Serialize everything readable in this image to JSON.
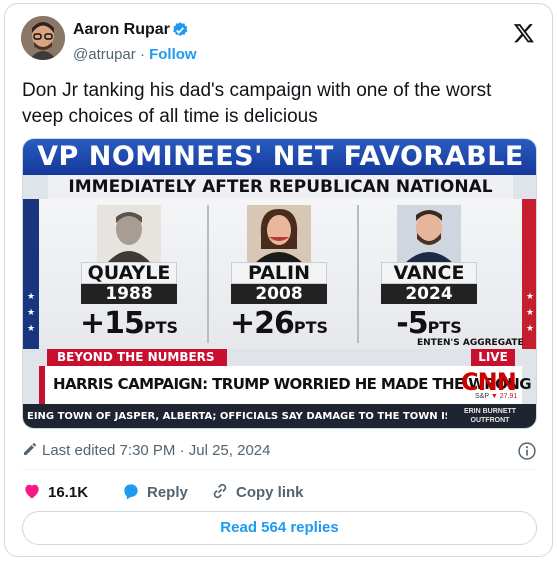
{
  "author": {
    "name": "Aaron Rupar",
    "handle": "@atrupar",
    "separator": "·",
    "follow_label": "Follow"
  },
  "tweet_text": "Don Jr tanking his dad's campaign with one of the worst veep choices of all time is delicious",
  "media": {
    "title": "VP NOMINEES' NET FAVORABLE RATING",
    "subtitle": "IMMEDIATELY AFTER REPUBLICAN NATIONAL CONVENTION",
    "candidates": [
      {
        "name": "QUAYLE",
        "year": "1988",
        "value": "+15",
        "unit": "PTS"
      },
      {
        "name": "PALIN",
        "year": "2008",
        "value": "+26",
        "unit": "PTS"
      },
      {
        "name": "VANCE",
        "year": "2024",
        "value": "-5",
        "unit": "PTS"
      }
    ],
    "aggregate_label": "ENTEN'S AGGREGATE",
    "segment_label": "BEYOND THE NUMBERS",
    "live_label": "LIVE",
    "headline": "HARRIS CAMPAIGN: TRUMP WORRIED HE MADE THE WRONG VP PICK",
    "network": "CNN",
    "sp_label": "S&P",
    "sp_value": "▼ 27.91",
    "ticker": "EING TOWN OF JASPER, ALBERTA; OFFICIALS SAY DAMAGE TO THE TOWN IS SIGNIFICANT",
    "show_line1": "ERIN BURNETT",
    "show_line2": "OUTFRONT"
  },
  "meta": {
    "edited": "Last edited 7:30 PM · Jul 25, 2024"
  },
  "actions": {
    "likes": "16.1K",
    "reply": "Reply",
    "copy_link": "Copy link"
  },
  "read_replies": "Read 564 replies",
  "colors": {
    "accent": "#1d9bf0",
    "like": "#f91880",
    "cnn_red": "#c8102e",
    "title_blue": "#15379a"
  }
}
